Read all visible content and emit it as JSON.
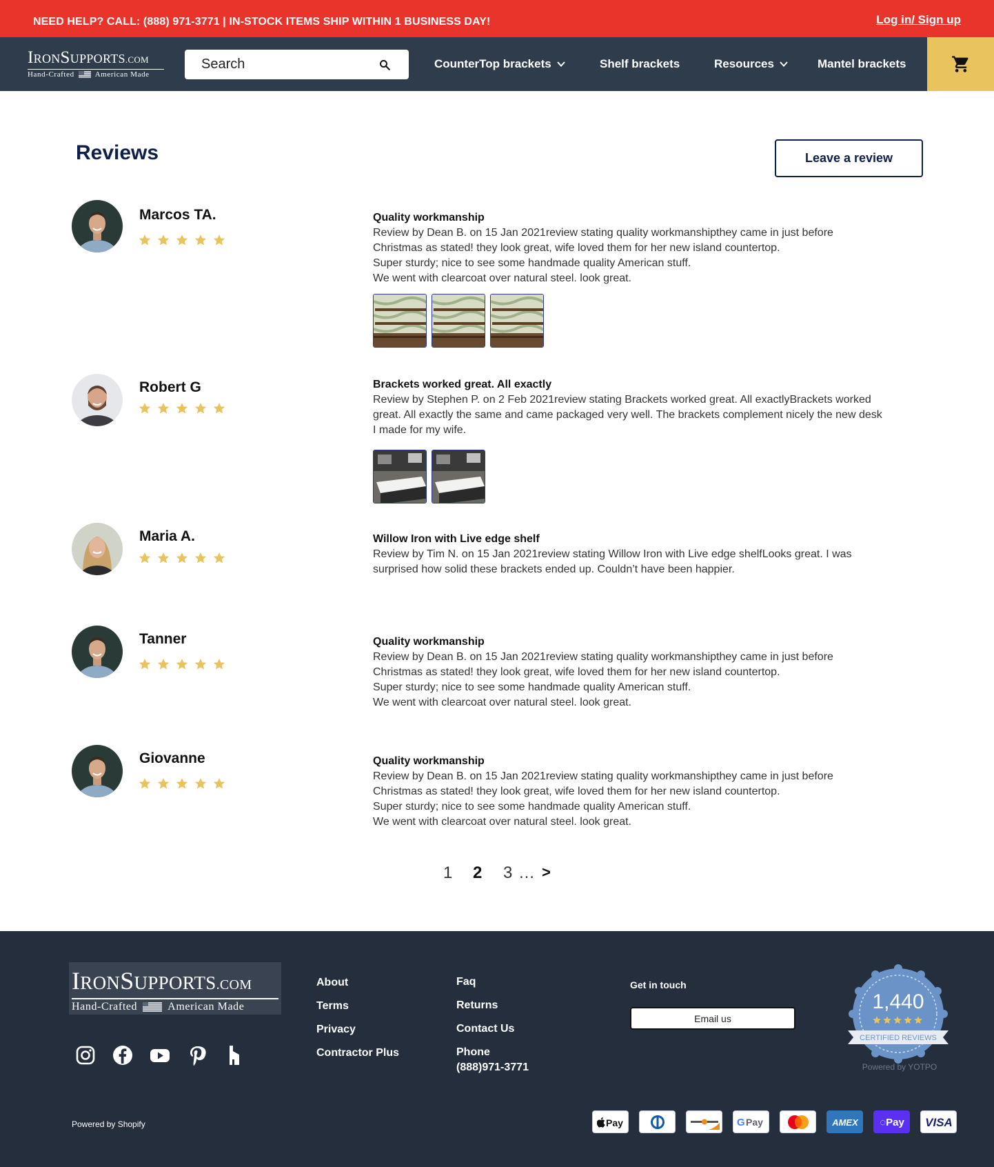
{
  "topbar": {
    "notice": "NEED HELP? CALL: (888) 971-3771 | IN-STOCK ITEMS SHIP WITHIN 1 BUSINESS DAY!",
    "login": "Log in/ Sign up"
  },
  "logo": {
    "brand_initial_1": "I",
    "brand_part_1": "RON",
    "brand_initial_2": "S",
    "brand_part_2": "UPPORTS",
    "domain": ".COM",
    "tagline_left": "Hand-Crafted",
    "tagline_right": "American Made"
  },
  "search": {
    "placeholder": "Search"
  },
  "nav": {
    "items": [
      {
        "label": "CounterTop brackets",
        "has_dropdown": true
      },
      {
        "label": "Shelf brackets",
        "has_dropdown": false
      },
      {
        "label": "Resources",
        "has_dropdown": true
      },
      {
        "label": "Mantel brackets",
        "has_dropdown": false
      }
    ],
    "cart_icon": "cart-icon"
  },
  "reviews": {
    "heading": "Reviews",
    "leave_button": "Leave a review",
    "items": [
      {
        "name": "Marcos TA.",
        "rating": 5,
        "title": "Quality workmanship",
        "body": [
          "Review by Dean B. on 15 Jan 2021review stating quality workmanshipthey came in just before",
          "Christmas as stated! they look great, wife loved them for her new island countertop.",
          "Super sturdy; nice to see some handmade quality American stuff.",
          "We went with clearcoat over natural steel. look great."
        ],
        "photo_count": 3
      },
      {
        "name": "Robert G",
        "rating": 5,
        "title": "Brackets worked great. All exactly",
        "body": [
          "Review by Stephen P. on 2 Feb 2021review stating Brackets worked great. All exactlyBrackets worked",
          "great. All exactly the same and came packaged very well. The brackets complement nicely the new desk",
          "I made for my wife."
        ],
        "photo_count": 2
      },
      {
        "name": "Maria A.",
        "rating": 5,
        "title": "Willow Iron with Live edge shelf",
        "body": [
          "Review by Tim N. on 15 Jan 2021review stating Willow Iron with Live edge shelfLooks great. I was",
          "surprised how solid these brackets ended up. Couldn’t have been happier."
        ],
        "photo_count": 0
      },
      {
        "name": "Tanner",
        "rating": 5,
        "title": "Quality workmanship",
        "body": [
          "Review by Dean B. on 15 Jan 2021review stating quality workmanshipthey came in just before",
          "Christmas as stated! they look great, wife loved them for her new island countertop.",
          "Super sturdy; nice to see some handmade quality American stuff.",
          "We went with clearcoat over natural steel. look great."
        ],
        "photo_count": 0
      },
      {
        "name": "Giovanne",
        "rating": 5,
        "title": "Quality workmanship",
        "body": [
          "Review by Dean B. on 15 Jan 2021review stating quality workmanshipthey came in just before",
          "Christmas as stated! they look great, wife loved them for her new island countertop.",
          "Super sturdy; nice to see some handmade quality American stuff.",
          "We went with clearcoat over natural steel. look great."
        ],
        "photo_count": 0
      }
    ]
  },
  "pagination": {
    "pages": [
      "1",
      "2",
      "3"
    ],
    "current": "2",
    "ellipsis": "…",
    "next": ">"
  },
  "footer": {
    "col1": [
      "About",
      "Terms",
      "Privacy",
      "Contractor Plus"
    ],
    "col2": [
      "Faq",
      "Returns",
      "Contact Us"
    ],
    "phone_label": "Phone",
    "phone_number": "(888)971-3771",
    "get_in_touch": "Get in touch",
    "email_button": "Email us",
    "badge_count": "1,440",
    "badge_text": "CERTIFIED REVIEWS",
    "powered_yotpo": "Powered by YOTPO",
    "powered_shopify": "Powered by Shopify",
    "socials": [
      "instagram-icon",
      "facebook-icon",
      "youtube-icon",
      "pinterest-icon",
      "houzz-icon"
    ],
    "payments": [
      "Apple Pay",
      "Diners Club",
      "Discover",
      "Google Pay",
      "Mastercard",
      "American Express",
      "Shop Pay",
      "Visa"
    ]
  },
  "colors": {
    "topbar": "#e8342a",
    "nav": "#2f3c4c",
    "cart": "#e9c35e",
    "heading": "#0f1f4b",
    "star": "#e9c35e",
    "footer": "#252e3d"
  }
}
